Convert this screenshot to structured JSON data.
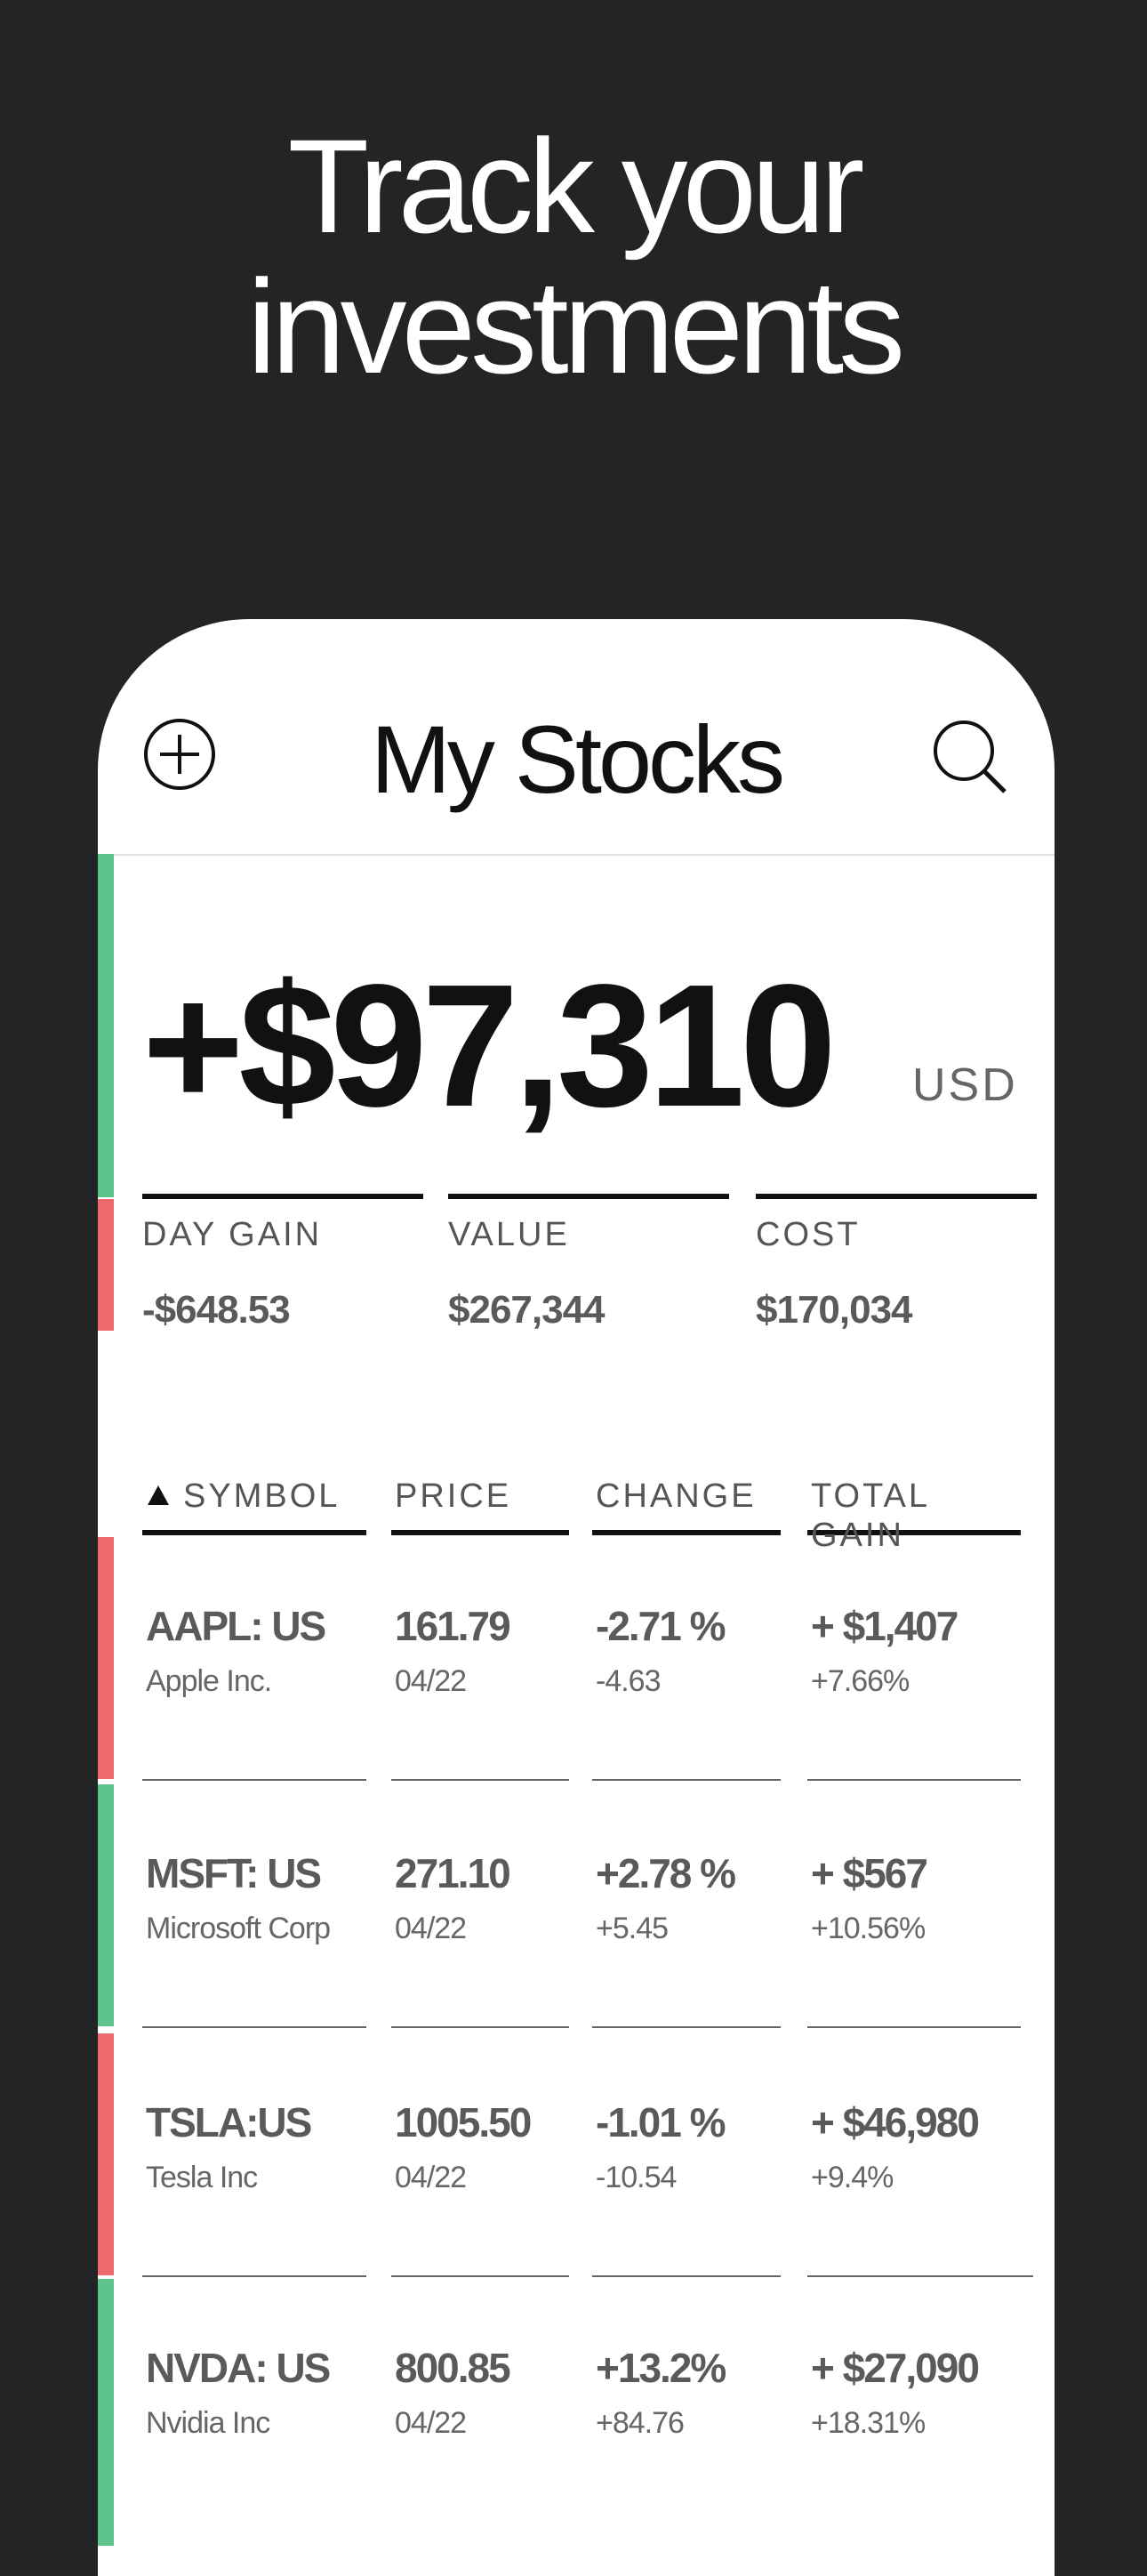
{
  "headline": {
    "line1": "Track your",
    "line2": "investments"
  },
  "header": {
    "title": "My Stocks"
  },
  "icons": {
    "add": "plus-circle-icon",
    "search": "search-icon"
  },
  "colors": {
    "gain": "#5ec48c",
    "loss": "#ef6b6b",
    "background": "#232426"
  },
  "summary": {
    "total_gain": "+$97,310",
    "currency": "USD",
    "day_gain_label": "DAY GAIN",
    "day_gain_value": "-$648.53",
    "value_label": "VALUE",
    "value_value": "$267,344",
    "cost_label": "COST",
    "cost_value": "$170,034"
  },
  "table": {
    "columns": [
      "SYMBOL",
      "PRICE",
      "CHANGE",
      "TOTAL GAIN"
    ],
    "sort": "ascending",
    "rows": [
      {
        "symbol": "AAPL: US",
        "name": "Apple Inc.",
        "price": "161.79",
        "date": "04/22",
        "change_pct": "-2.71 %",
        "change_abs": "-4.63",
        "total_gain": "+ $1,407",
        "total_gain_pct": "+7.66%",
        "trend": "loss"
      },
      {
        "symbol": "MSFT: US",
        "name": "Microsoft Corp",
        "price": "271.10",
        "date": "04/22",
        "change_pct": "+2.78 %",
        "change_abs": "+5.45",
        "total_gain": "+ $567",
        "total_gain_pct": "+10.56%",
        "trend": "gain"
      },
      {
        "symbol": "TSLA:US",
        "name": "Tesla Inc",
        "price": "1005.50",
        "date": "04/22",
        "change_pct": "-1.01 %",
        "change_abs": "-10.54",
        "total_gain": "+ $46,980",
        "total_gain_pct": "+9.4%",
        "trend": "loss"
      },
      {
        "symbol": "NVDA: US",
        "name": "Nvidia Inc",
        "price": "800.85",
        "date": "04/22",
        "change_pct": "+13.2%",
        "change_abs": "+84.76",
        "total_gain": "+ $27,090",
        "total_gain_pct": "+18.31%",
        "trend": "gain"
      }
    ]
  }
}
